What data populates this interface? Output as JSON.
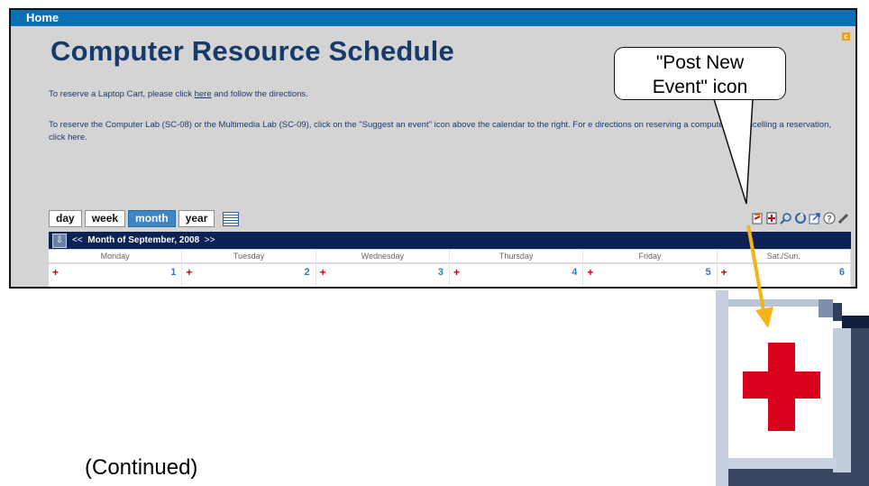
{
  "topbar": {
    "home_label": "Home"
  },
  "page": {
    "title": "Computer Resource Schedule",
    "para1_prefix": "To reserve a Laptop Cart, please click ",
    "para1_link": "here",
    "para1_suffix": " and follow the directions.",
    "para2": "To reserve the Computer Lab (SC-08) or the Multimedia Lab (SC-09), click on the \"Suggest an event\" icon above the calendar to the right.  For          e directions on reserving a computer or cancelling a reservation, click here."
  },
  "view_tabs": [
    "day",
    "week",
    "month",
    "year"
  ],
  "active_tab": "month",
  "toolbar_icons": [
    "clipboard-icon",
    "post-new-event-icon",
    "search-icon",
    "refresh-icon",
    "export-icon",
    "help-icon",
    "edit-icon"
  ],
  "calendar": {
    "prev": "<<",
    "month_label": "Month of September, 2008",
    "next": ">>",
    "day_headers": [
      "Monday",
      "Tuesday",
      "Wednesday",
      "Thursday",
      "Friday",
      "Sat./Sun."
    ],
    "day_numbers": [
      "1",
      "2",
      "3",
      "4",
      "5",
      "6"
    ],
    "plus_symbol": "+"
  },
  "callout": {
    "line1": "\"Post New",
    "line2": "Event\" icon"
  },
  "caption": "(Continued)",
  "colors": {
    "topbar": "#0a6fb3",
    "title": "#163b6b",
    "monthbar": "#0c2255",
    "arrow": "#f2b418",
    "plus": "#c8001b"
  }
}
